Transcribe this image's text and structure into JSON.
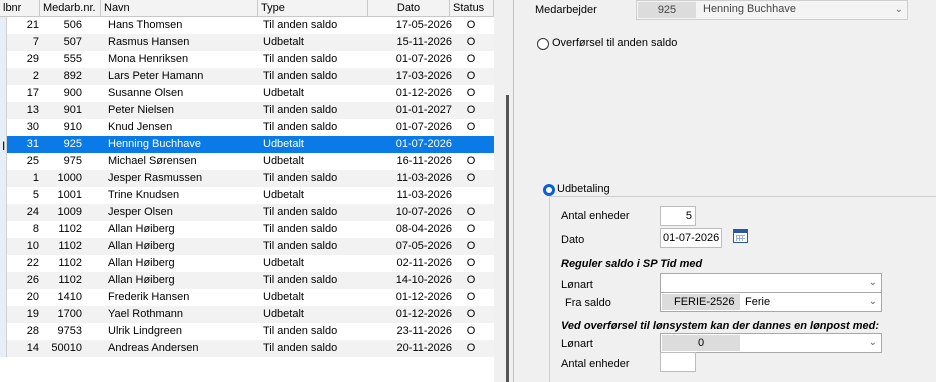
{
  "grid": {
    "columns": [
      "lbnr",
      "Medarb.nr.",
      "Navn",
      "Type",
      "Dato",
      "Status"
    ],
    "rows": [
      {
        "lbnr": "21",
        "med": "506",
        "name": "Hans Thomsen",
        "type": "Til anden saldo",
        "date": "17-05-2026",
        "status": "O"
      },
      {
        "lbnr": "7",
        "med": "507",
        "name": "Rasmus Hansen",
        "type": "Udbetalt",
        "date": "15-11-2026",
        "status": "O"
      },
      {
        "lbnr": "29",
        "med": "555",
        "name": "Mona Henriksen",
        "type": "Til anden saldo",
        "date": "01-07-2026",
        "status": "O"
      },
      {
        "lbnr": "2",
        "med": "892",
        "name": "Lars Peter Hamann",
        "type": "Til anden saldo",
        "date": "17-03-2026",
        "status": "O"
      },
      {
        "lbnr": "17",
        "med": "900",
        "name": "Susanne Olsen",
        "type": "Udbetalt",
        "date": "01-12-2026",
        "status": "O"
      },
      {
        "lbnr": "13",
        "med": "901",
        "name": "Peter Nielsen",
        "type": "Til anden saldo",
        "date": "01-01-2027",
        "status": "O"
      },
      {
        "lbnr": "30",
        "med": "910",
        "name": "Knud Jensen",
        "type": "Til anden saldo",
        "date": "01-07-2026",
        "status": "O"
      },
      {
        "lbnr": "31",
        "med": "925",
        "name": "Henning Buchhave",
        "type": "Udbetalt",
        "date": "01-07-2026",
        "status": "",
        "selected": true
      },
      {
        "lbnr": "25",
        "med": "975",
        "name": "Michael Sørensen",
        "type": "Udbetalt",
        "date": "16-11-2026",
        "status": "O"
      },
      {
        "lbnr": "1",
        "med": "1000",
        "name": "Jesper Rasmussen",
        "type": "Til anden saldo",
        "date": "11-03-2026",
        "status": "O"
      },
      {
        "lbnr": "5",
        "med": "1001",
        "name": "Trine Knudsen",
        "type": "Udbetalt",
        "date": "11-03-2026",
        "status": ""
      },
      {
        "lbnr": "24",
        "med": "1009",
        "name": "Jesper Olsen",
        "type": "Til anden saldo",
        "date": "10-07-2026",
        "status": "O"
      },
      {
        "lbnr": "8",
        "med": "1102",
        "name": "Allan Høiberg",
        "type": "Til anden saldo",
        "date": "08-04-2026",
        "status": "O"
      },
      {
        "lbnr": "10",
        "med": "1102",
        "name": "Allan Høiberg",
        "type": "Til anden saldo",
        "date": "07-05-2026",
        "status": "O"
      },
      {
        "lbnr": "22",
        "med": "1102",
        "name": "Allan Høiberg",
        "type": "Udbetalt",
        "date": "02-11-2026",
        "status": "O"
      },
      {
        "lbnr": "26",
        "med": "1102",
        "name": "Allan Høiberg",
        "type": "Til anden saldo",
        "date": "14-10-2026",
        "status": "O"
      },
      {
        "lbnr": "20",
        "med": "1410",
        "name": "Frederik Hansen",
        "type": "Udbetalt",
        "date": "01-12-2026",
        "status": "O"
      },
      {
        "lbnr": "19",
        "med": "1700",
        "name": "Yael Rothmann",
        "type": "Udbetalt",
        "date": "01-12-2026",
        "status": "O"
      },
      {
        "lbnr": "28",
        "med": "9753",
        "name": "Ulrik Lindgreen",
        "type": "Til anden saldo",
        "date": "23-11-2026",
        "status": "O"
      },
      {
        "lbnr": "14",
        "med": "50010",
        "name": "Andreas Andersen",
        "type": "Til anden saldo",
        "date": "20-11-2026",
        "status": "O"
      }
    ]
  },
  "form": {
    "employee_label": "Medarbejder",
    "employee_number": "925",
    "employee_name": "Henning Buchhave",
    "transfer_radio_label": "Overførsel til anden saldo",
    "payout_radio_label": "Udbetaling",
    "units_label": "Antal enheder",
    "units_value": "5",
    "date_label": "Dato",
    "date_value": "01-07-2026",
    "adjust_heading": "Reguler saldo i SP Tid med",
    "wage_type_label": "Lønart",
    "wage_type_value": "",
    "from_balance_label": "Fra saldo",
    "from_balance_code": "FERIE-2526",
    "from_balance_name": "Ferie",
    "transfer_heading": "Ved overførsel til lønsystem kan der dannes en lønpost med:",
    "wage_type2_label": "Lønart",
    "wage_type2_value": "0",
    "units2_label": "Antal enheder",
    "units2_value": ""
  }
}
